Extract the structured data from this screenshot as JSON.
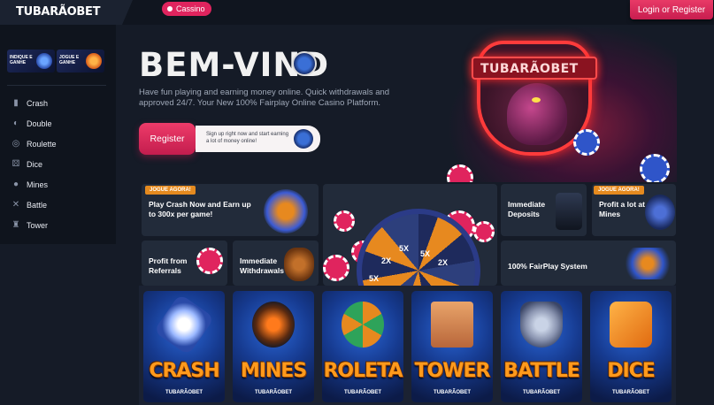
{
  "header": {
    "logo": "TUBARÃOBET",
    "nav_tab": "Cassino",
    "login_label": "Login or Register"
  },
  "sidebar": {
    "promos": [
      {
        "text": "INDIQUE E GANHE",
        "color": "#6aa4ff",
        "icon": "gift-icon"
      },
      {
        "text": "JOGUE E GANHE",
        "color": "#ffb347",
        "icon": "money-bag-icon"
      }
    ],
    "items": [
      {
        "label": "Crash",
        "icon": "chart-icon"
      },
      {
        "label": "Double",
        "icon": "double-icon"
      },
      {
        "label": "Roulette",
        "icon": "roulette-icon"
      },
      {
        "label": "Dice",
        "icon": "dice-icon"
      },
      {
        "label": "Mines",
        "icon": "bomb-icon"
      },
      {
        "label": "Battle",
        "icon": "battle-icon"
      },
      {
        "label": "Tower",
        "icon": "tower-icon"
      }
    ]
  },
  "hero": {
    "title": "BEM-VIND",
    "subtitle": "Have fun playing and earning money online. Quick withdrawals and approved 24/7. Your New 100% Fairplay Online Casino Platform.",
    "register_label": "Register",
    "register_hint": "Sign up right now and start earning a lot of money online!",
    "art_banner": "TUBARÃOBET"
  },
  "features": [
    {
      "tag": "JOGUE AGORA!",
      "text": "Play Crash Now and Earn up to 300x per game!"
    },
    {
      "text": "Immediate Deposits"
    },
    {
      "tag": "JOGUE AGORA!",
      "text": "Profit a lot at Mines"
    },
    {
      "text": "Profit from Referrals"
    },
    {
      "text": "Immediate Withdrawals"
    },
    {
      "text": "100% FairPlay System"
    }
  ],
  "wheel": {
    "labels": [
      "2X",
      "5X",
      "5X",
      "2X",
      "5X"
    ]
  },
  "games": [
    {
      "title": "CRASH",
      "brand": "TUBARÃOBET",
      "icon": "rocket-icon"
    },
    {
      "title": "MINES",
      "brand": "TUBARÃOBET",
      "icon": "bomb-icon"
    },
    {
      "title": "ROLETA",
      "brand": "TUBARÃOBET",
      "icon": "roulette-icon"
    },
    {
      "title": "TOWER",
      "brand": "TUBARÃOBET",
      "icon": "tower-icon"
    },
    {
      "title": "BATTLE",
      "brand": "TUBARÃOBET",
      "icon": "battle-icon"
    },
    {
      "title": "DICE",
      "brand": "TUBARÃOBET",
      "icon": "dice-icon"
    }
  ],
  "colors": {
    "accent": "#e0245e",
    "orange": "#e58a1f",
    "background": "#151b27"
  }
}
